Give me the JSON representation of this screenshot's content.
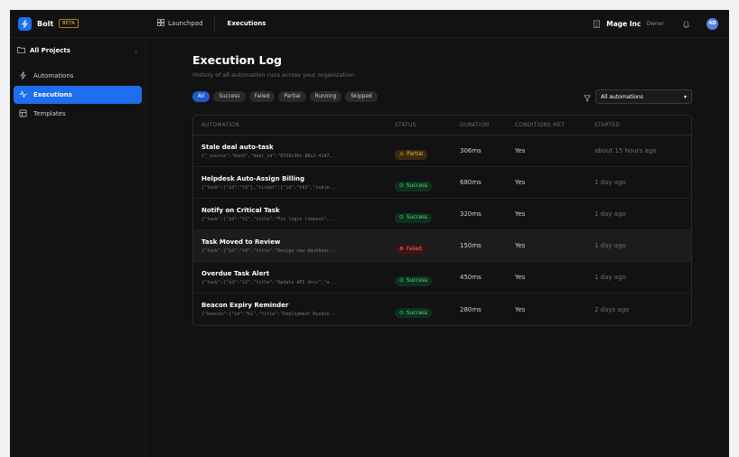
{
  "brand": {
    "name": "Bolt",
    "badge": "BETA"
  },
  "topnav": {
    "launchpad": "Launchpad",
    "breadcrumb": "Executions"
  },
  "org": {
    "name": "Mage Inc",
    "role": "Owner",
    "avatar_initials": "AD"
  },
  "sidebar": {
    "project": "All Projects",
    "items": [
      {
        "label": "Automations",
        "icon": "bolt-icon"
      },
      {
        "label": "Executions",
        "icon": "activity-icon",
        "active": true
      },
      {
        "label": "Templates",
        "icon": "template-icon"
      }
    ]
  },
  "page": {
    "title": "Execution Log",
    "subtitle": "History of all automation runs across your organization."
  },
  "filters": {
    "chips": [
      "All",
      "Success",
      "Failed",
      "Partial",
      "Running",
      "Skipped"
    ],
    "active": "All",
    "select_value": "All automations"
  },
  "table": {
    "headers": [
      "AUTOMATION",
      "STATUS",
      "DURATION",
      "CONDITIONS MET",
      "STARTED"
    ],
    "rows": [
      {
        "name": "Stale deal auto-task",
        "payload": "{\"_source\":\"bond\",\"deal_id\":\"6559c30c-88c2-41d7...",
        "status": "Partial",
        "duration": "306ms",
        "conditions": "Yes",
        "started": "about 15 hours ago"
      },
      {
        "name": "Helpdesk Auto-Assign Billing",
        "payload": "{\"task\":{\"id\":\"t3\"},\"ticket\":{\"id\":\"tk1\",\"subje...",
        "status": "Success",
        "duration": "680ms",
        "conditions": "Yes",
        "started": "1 day ago"
      },
      {
        "name": "Notify on Critical Task",
        "payload": "{\"task\":{\"id\":\"t1\",\"title\":\"Fix login timeout\",...",
        "status": "Success",
        "duration": "320ms",
        "conditions": "Yes",
        "started": "1 day ago"
      },
      {
        "name": "Task Moved to Review",
        "payload": "{\"task\":{\"id\":\"t4\",\"title\":\"Design new dashboar...",
        "status": "Failed",
        "duration": "150ms",
        "conditions": "Yes",
        "started": "1 day ago"
      },
      {
        "name": "Overdue Task Alert",
        "payload": "{\"task\":{\"id\":\"t2\",\"title\":\"Update API docs\",\"a...",
        "status": "Success",
        "duration": "450ms",
        "conditions": "Yes",
        "started": "1 day ago"
      },
      {
        "name": "Beacon Expiry Reminder",
        "payload": "{\"beacon\":{\"id\":\"b1\",\"title\":\"Deployment Runboo...",
        "status": "Success",
        "duration": "280ms",
        "conditions": "Yes",
        "started": "2 days ago"
      }
    ]
  },
  "colors": {
    "accent": "#1e6ef0",
    "success": "#4ade80",
    "partial": "#f5b942",
    "failed": "#f87171"
  }
}
